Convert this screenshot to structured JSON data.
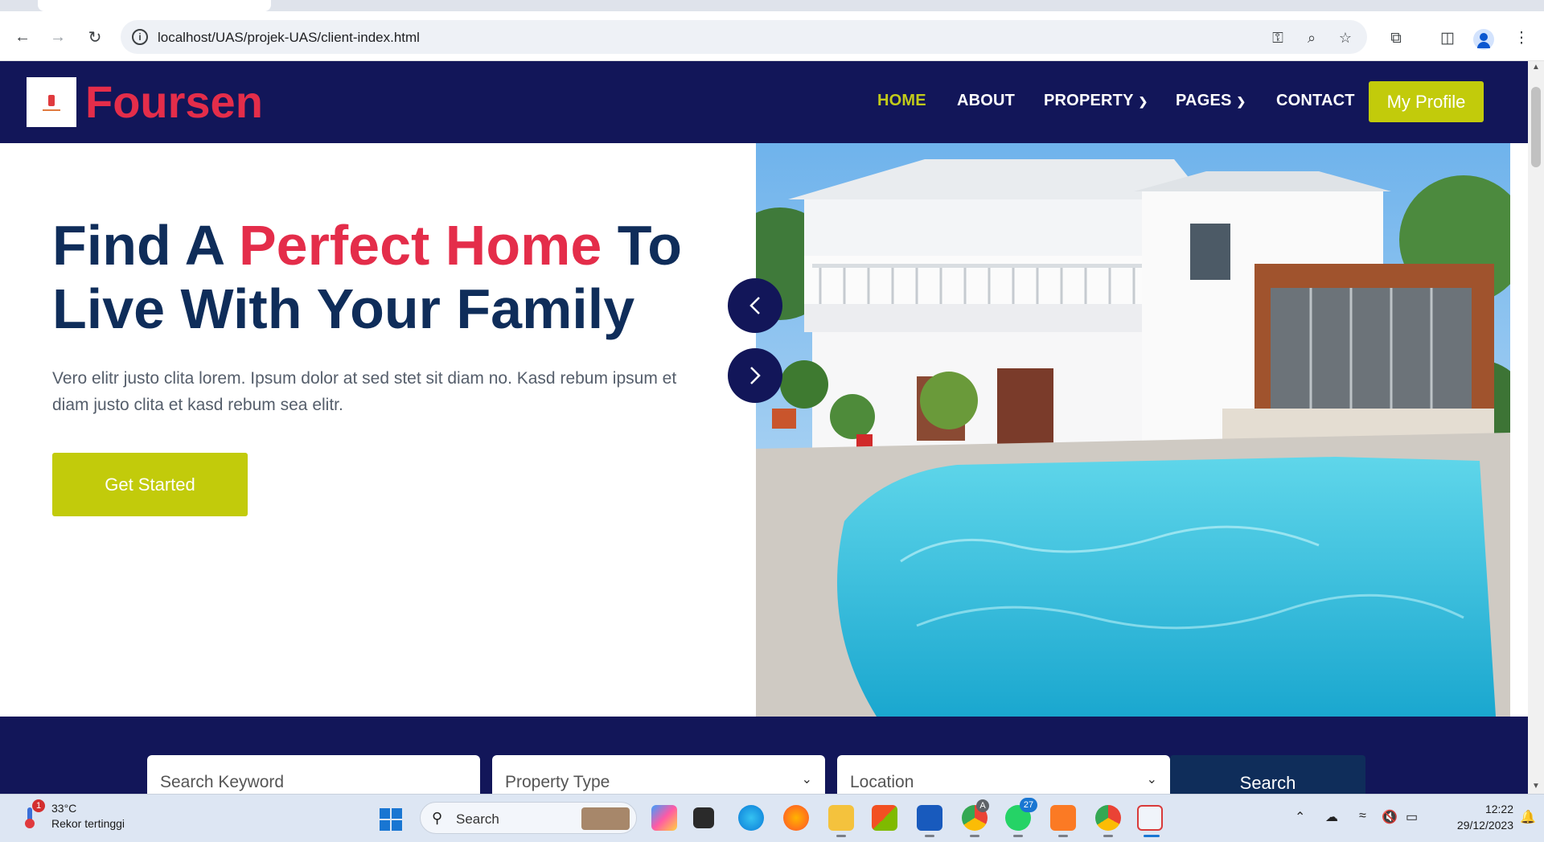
{
  "browser": {
    "url": "localhost/UAS/projek-UAS/client-index.html"
  },
  "site": {
    "brand": "Foursen",
    "menu": [
      {
        "label": "HOME"
      },
      {
        "label": "ABOUT"
      },
      {
        "label": "PROPERTY"
      },
      {
        "label": "PAGES"
      },
      {
        "label": "CONTACT"
      }
    ],
    "profile_button": "My Profile"
  },
  "hero": {
    "title_part1": "Find A ",
    "title_accent": "Perfect Home",
    "title_part2": " To Live With Your Family",
    "text": "Vero elitr justo clita lorem. Ipsum dolor at sed stet sit diam no. Kasd rebum ipsum et diam justo clita et kasd rebum sea elitr.",
    "cta": "Get Started"
  },
  "search": {
    "keyword_placeholder": "Search Keyword",
    "type_placeholder": "Property Type",
    "location_placeholder": "Location",
    "button": "Search"
  },
  "taskbar": {
    "weather_temp": "33°C",
    "weather_desc": "Rekor tertinggi",
    "weather_badge": "1",
    "search_label": "Search",
    "whatsapp_badge": "27",
    "chrome_badge": "A",
    "time": "12:22",
    "date": "29/12/2023"
  },
  "colors": {
    "nav_bg": "#121659",
    "brand_red": "#e42d4a",
    "accent_lime": "#c2cb0b",
    "heading_navy": "#0f2d5a"
  }
}
